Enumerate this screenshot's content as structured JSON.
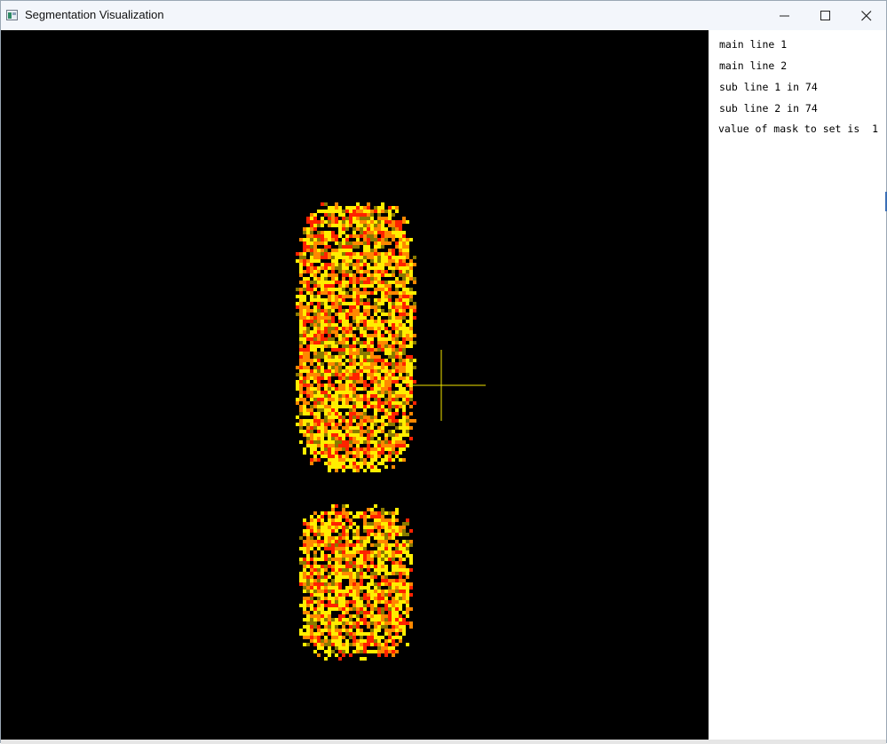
{
  "window": {
    "title": "Segmentation Visualization",
    "icon": "app-window-icon"
  },
  "controls": {
    "minimize_icon": "minimize-icon",
    "maximize_icon": "maximize-icon",
    "close_icon": "close-icon"
  },
  "colors": {
    "canvas_background": "#000000",
    "segmentation_red": "#ff2200",
    "segmentation_orange": "#ff8800",
    "segmentation_yellow": "#ffee00",
    "segmentation_dark_yellow": "#8a7a00",
    "crosshair": "#f2e400",
    "panel_background": "#ffffff"
  },
  "info_panel": {
    "lines": [
      "main line 1",
      "main line 2",
      "sub line 1 in 74",
      "sub line 2 in 74",
      "value of mask to set is  1"
    ]
  }
}
